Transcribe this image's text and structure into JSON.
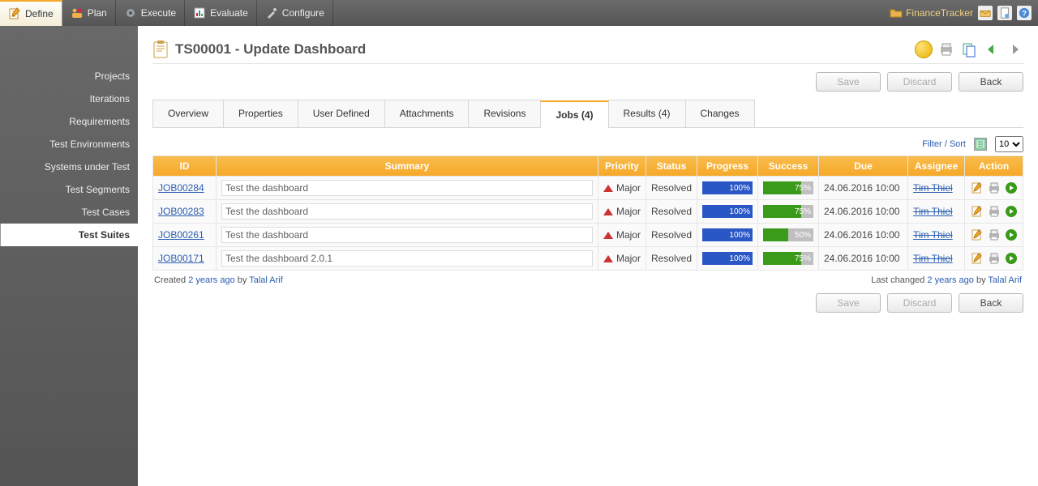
{
  "topnav": {
    "tabs": [
      {
        "label": "Define",
        "active": true
      },
      {
        "label": "Plan"
      },
      {
        "label": "Execute"
      },
      {
        "label": "Evaluate"
      },
      {
        "label": "Configure"
      }
    ],
    "project": "FinanceTracker"
  },
  "sidebar": {
    "items": [
      {
        "label": "Projects"
      },
      {
        "label": "Iterations"
      },
      {
        "label": "Requirements"
      },
      {
        "label": "Test Environments"
      },
      {
        "label": "Systems under Test"
      },
      {
        "label": "Test Segments"
      },
      {
        "label": "Test Cases"
      },
      {
        "label": "Test Suites",
        "active": true
      }
    ]
  },
  "page": {
    "title": "TS00001 - Update Dashboard",
    "buttons": {
      "save": "Save",
      "discard": "Discard",
      "back": "Back"
    }
  },
  "tabs": [
    {
      "label": "Overview"
    },
    {
      "label": "Properties"
    },
    {
      "label": "User Defined"
    },
    {
      "label": "Attachments"
    },
    {
      "label": "Revisions"
    },
    {
      "label": "Jobs (4)",
      "active": true
    },
    {
      "label": "Results (4)"
    },
    {
      "label": "Changes"
    }
  ],
  "filter": {
    "label": "Filter / Sort",
    "pagesize": "10"
  },
  "table": {
    "headers": {
      "id": "ID",
      "summary": "Summary",
      "priority": "Priority",
      "status": "Status",
      "progress": "Progress",
      "success": "Success",
      "due": "Due",
      "assignee": "Assignee",
      "action": "Action"
    },
    "rows": [
      {
        "id": "JOB00284",
        "summary": "Test the dashboard",
        "priority": "Major",
        "status": "Resolved",
        "progress": 100,
        "success": 75,
        "due": "24.06.2016 10:00",
        "assignee": "Tim Thiel"
      },
      {
        "id": "JOB00283",
        "summary": "Test the dashboard",
        "priority": "Major",
        "status": "Resolved",
        "progress": 100,
        "success": 75,
        "due": "24.06.2016 10:00",
        "assignee": "Tim Thiel"
      },
      {
        "id": "JOB00261",
        "summary": "Test the dashboard",
        "priority": "Major",
        "status": "Resolved",
        "progress": 100,
        "success": 50,
        "due": "24.06.2016 10:00",
        "assignee": "Tim Thiel"
      },
      {
        "id": "JOB00171",
        "summary": "Test the dashboard 2.0.1",
        "priority": "Major",
        "status": "Resolved",
        "progress": 100,
        "success": 75,
        "due": "24.06.2016 10:00",
        "assignee": "Tim Thiel"
      }
    ]
  },
  "meta": {
    "created_prefix": "Created ",
    "created_ago": "2 years ago",
    "created_by": " by ",
    "created_user": "Talal Arif",
    "changed_prefix": "Last changed ",
    "changed_ago": "2 years ago",
    "changed_by": " by ",
    "changed_user": "Talal Arif"
  }
}
